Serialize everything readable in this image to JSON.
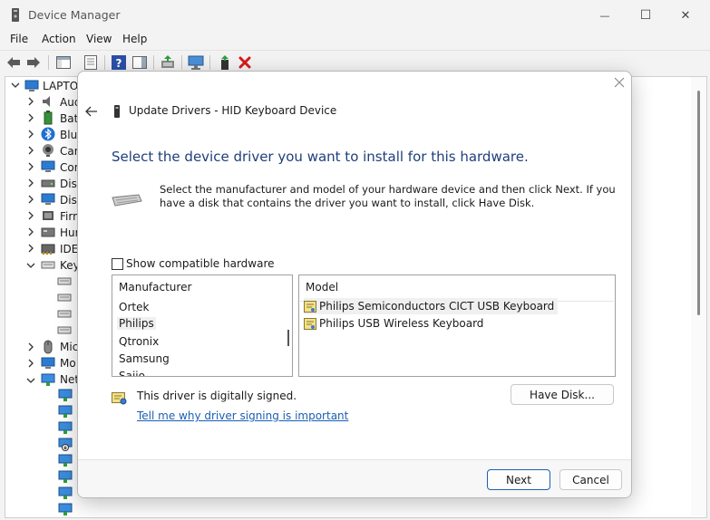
{
  "window": {
    "title": "Device Manager",
    "minimize_glyph": "—",
    "maximize_glyph": "☐",
    "close_glyph": "✕"
  },
  "menu": {
    "items": [
      {
        "label": "File"
      },
      {
        "label": "Action"
      },
      {
        "label": "View"
      },
      {
        "label": "Help"
      }
    ]
  },
  "tree": {
    "root_label": "LAPTOP",
    "items": [
      {
        "label": "Aud",
        "icon": "speaker-icon"
      },
      {
        "label": "Batt",
        "icon": "battery-icon"
      },
      {
        "label": "Blue",
        "icon": "bluetooth-icon"
      },
      {
        "label": "Cam",
        "icon": "camera-icon"
      },
      {
        "label": "Com",
        "icon": "monitor-icon"
      },
      {
        "label": "Disk",
        "icon": "disk-icon"
      },
      {
        "label": "Disp",
        "icon": "display-icon"
      },
      {
        "label": "Firm",
        "icon": "firmware-icon"
      },
      {
        "label": "Hum",
        "icon": "hid-icon"
      },
      {
        "label": "IDE",
        "icon": "ide-icon"
      },
      {
        "label": "Key",
        "icon": "keyboard-icon"
      },
      {
        "label": "Mic",
        "icon": "mouse-icon"
      },
      {
        "label": "Mo",
        "icon": "monitor-icon"
      },
      {
        "label": "Net",
        "icon": "network-icon"
      }
    ]
  },
  "dialog": {
    "title": "Update Drivers - HID Keyboard Device",
    "heading": "Select the device driver you want to install for this hardware.",
    "description": "Select the manufacturer and model of your hardware device and then click Next. If you have a disk that contains the driver you want to install, click Have Disk.",
    "show_compatible_label": "Show compatible hardware",
    "show_compatible_checked": false,
    "manufacturer": {
      "header": "Manufacturer",
      "items": [
        "Ortek",
        "Philips",
        "Qtronix",
        "Samsung",
        "Saijo"
      ],
      "selected": "Philips"
    },
    "model": {
      "header": "Model",
      "items": [
        "Philips Semiconductors CICT USB Keyboard",
        "Philips USB Wireless Keyboard"
      ],
      "selected": "Philips Semiconductors CICT USB Keyboard"
    },
    "signed_text": "This driver is digitally signed.",
    "signing_link": "Tell me why driver signing is important",
    "have_disk_label": "Have Disk...",
    "next_label": "Next",
    "cancel_label": "Cancel"
  },
  "colors": {
    "accent": "#1a5fb4",
    "heading": "#1f3f7a",
    "delete_red": "#d8191b",
    "help_blue": "#2b4fa8"
  }
}
